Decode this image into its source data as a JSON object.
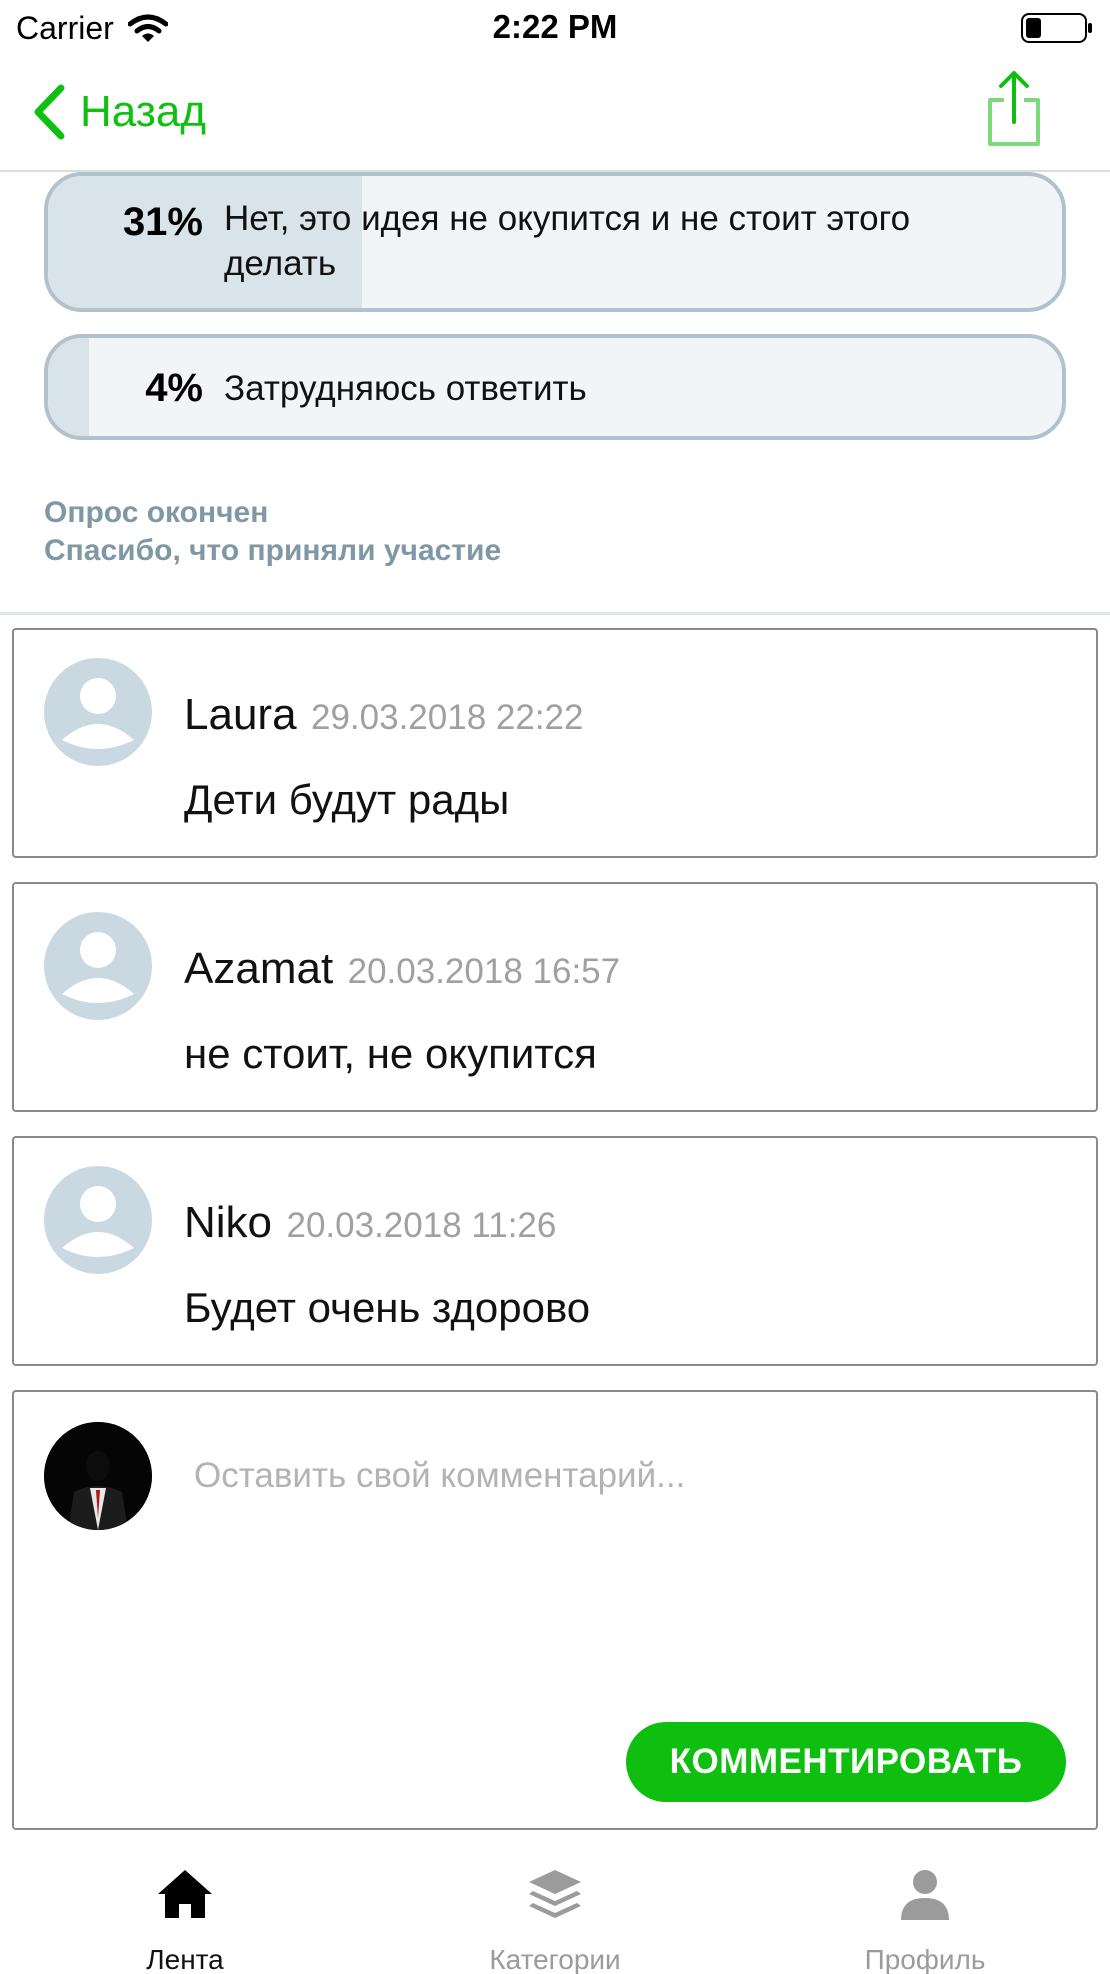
{
  "status_bar": {
    "carrier": "Carrier",
    "time": "2:22 PM"
  },
  "nav": {
    "back_label": "Назад",
    "share_icon": "share-icon"
  },
  "poll": {
    "options": [
      {
        "percent_label": "31%",
        "percent": 31,
        "text": "Нет, это идея не окупится и не стоит этого делать"
      },
      {
        "percent_label": "4%",
        "percent": 4,
        "text": "Затрудняюсь ответить"
      }
    ],
    "status_line1": "Опрос окончен",
    "status_line2": "Спасибо, что приняли участие"
  },
  "comments": [
    {
      "author": "Laura",
      "date": "29.03.2018 22:22",
      "text": "Дети будут рады"
    },
    {
      "author": "Azamat",
      "date": "20.03.2018 16:57",
      "text": "не стоит, не окупится"
    },
    {
      "author": "Niko",
      "date": "20.03.2018 11:26",
      "text": "Будет очень здорово"
    }
  ],
  "compose": {
    "placeholder": "Оставить свой комментарий...",
    "submit_label": "КОММЕНТИРОВАТЬ"
  },
  "tabs": [
    {
      "label": "Лента",
      "icon": "home-icon",
      "active": true
    },
    {
      "label": "Категории",
      "icon": "layers-icon",
      "active": false
    },
    {
      "label": "Профиль",
      "icon": "person-icon",
      "active": false
    }
  ],
  "colors": {
    "accent": "#10c010",
    "poll_border": "#b2c2cc",
    "poll_fill": "#d9e4ea",
    "muted_text": "#8098a4"
  }
}
